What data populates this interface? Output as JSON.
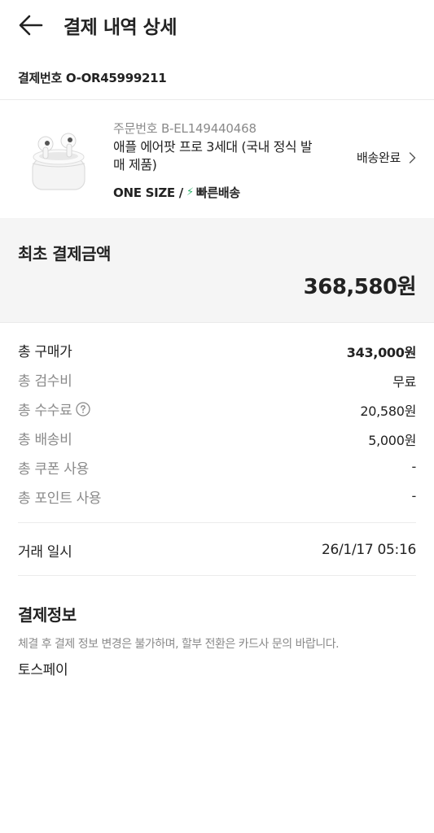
{
  "header": {
    "title": "결제 내역 상세"
  },
  "payment": {
    "number": "결제번호 O-OR45999211"
  },
  "product": {
    "order_number": "주문번호 B-EL149440468",
    "name": "애플 에어팟 프로 3세대 (국내 정식 발매 제품)",
    "size": "ONE SIZE /",
    "delivery_type": "빠른배송",
    "status": "배송완료"
  },
  "total": {
    "label": "최초 결제금액",
    "value": "368,580원"
  },
  "rows": [
    {
      "label": "총 구매가",
      "value": "343,000원"
    },
    {
      "label": "총 검수비",
      "value": "무료"
    },
    {
      "label": "총 수수료",
      "value": "20,580원"
    },
    {
      "label": "총 배송비",
      "value": "5,000원"
    },
    {
      "label": "총 쿠폰 사용",
      "value": "-"
    },
    {
      "label": "총 포인트 사용",
      "value": "-"
    }
  ],
  "trade": {
    "label": "거래 일시",
    "value": "26/1/17 05:16"
  },
  "payment_info": {
    "title": "결제정보",
    "notice": "체결 후 결제 정보 변경은 불가하며, 할부 전환은 카드사 문의 바랍니다.",
    "method": "토스페이"
  },
  "colors": {
    "fast_delivery": "#31b46e",
    "muted_text": "#8a8a8a",
    "total_bg": "#f5f5f5"
  },
  "icons": {
    "back": "arrow-left-icon",
    "chevron": "chevron-right-icon",
    "help": "question-circle-icon",
    "bolt": "lightning-icon"
  }
}
